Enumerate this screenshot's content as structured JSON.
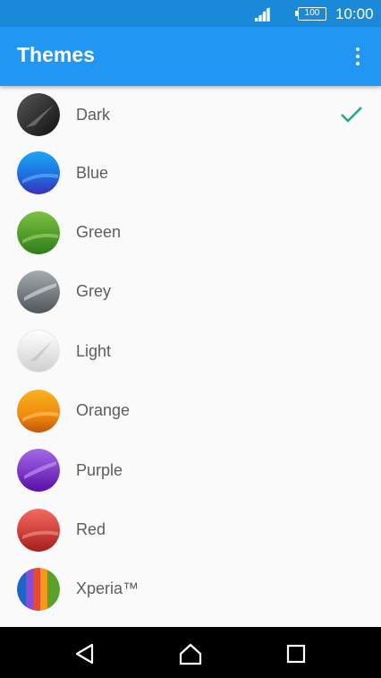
{
  "status_bar": {
    "battery": "100",
    "time": "10:00"
  },
  "app_bar": {
    "title": "Themes"
  },
  "themes": [
    {
      "label": "Dark",
      "selected": true,
      "colors": [
        "#555555",
        "#1a1a1a"
      ]
    },
    {
      "label": "Blue",
      "selected": false,
      "colors": [
        "#1a9cf0",
        "#3b2fb8"
      ]
    },
    {
      "label": "Green",
      "selected": false,
      "colors": [
        "#7ac043",
        "#2f7d1b"
      ]
    },
    {
      "label": "Grey",
      "selected": false,
      "colors": [
        "#9aa3a8",
        "#4f5559"
      ]
    },
    {
      "label": "Light",
      "selected": false,
      "colors": [
        "#ffffff",
        "#cfcfcf"
      ]
    },
    {
      "label": "Orange",
      "selected": false,
      "colors": [
        "#f7a81c",
        "#c2560a"
      ]
    },
    {
      "label": "Purple",
      "selected": false,
      "colors": [
        "#9b5de5",
        "#5a0ea6"
      ]
    },
    {
      "label": "Red",
      "selected": false,
      "colors": [
        "#f2645a",
        "#a81e1e"
      ]
    },
    {
      "label": "Xperia™",
      "selected": false,
      "colors": [
        "#e64b2e",
        "#1e63c8"
      ]
    }
  ],
  "colors": {
    "status_bar": "#1a8ad8",
    "app_bar": "#2196f3",
    "checkmark": "#1fa88a"
  }
}
